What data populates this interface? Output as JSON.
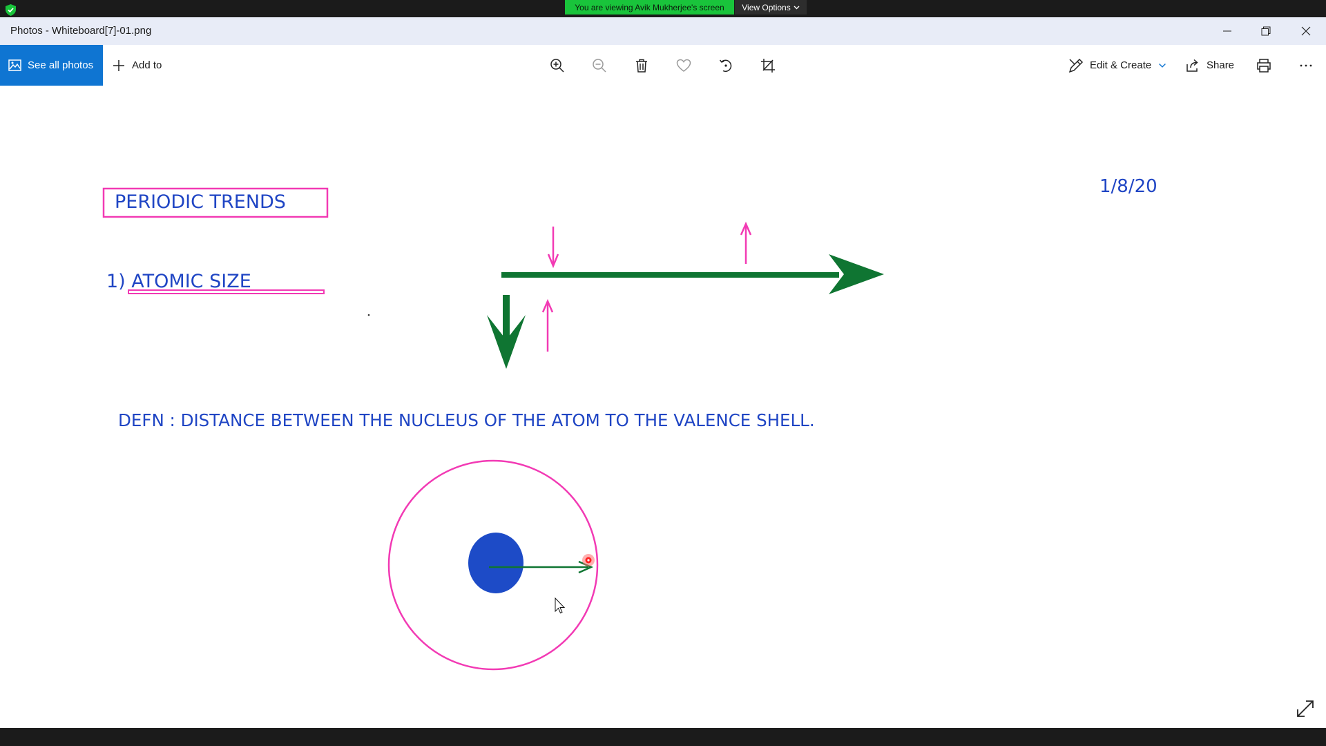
{
  "share_banner": {
    "message": "You are viewing Avik Mukherjee's screen",
    "view_options_label": "View Options"
  },
  "window": {
    "title": "Photos - Whiteboard[7]-01.png"
  },
  "toolbar": {
    "see_all_photos": "See all photos",
    "add_to": "Add to",
    "edit_create": "Edit & Create",
    "share": "Share",
    "icons": [
      "zoom-in-icon",
      "zoom-out-icon",
      "delete-icon",
      "favorite-icon",
      "rotate-icon",
      "crop-icon",
      "print-icon",
      "more-icon"
    ]
  },
  "whiteboard": {
    "title": "PERIODIC TRENDS",
    "date": "1/8/20",
    "topic": "1) ATOMIC SIZE",
    "definition": "DEFN : DISTANCE BETWEEN THE NUCLEUS OF THE ATOM TO THE VALENCE SHELL.",
    "colors": {
      "text": "#1f45c4",
      "highlight": "#f23ab4",
      "arrow": "#0f7532",
      "nucleus": "#1d4bc7"
    }
  }
}
